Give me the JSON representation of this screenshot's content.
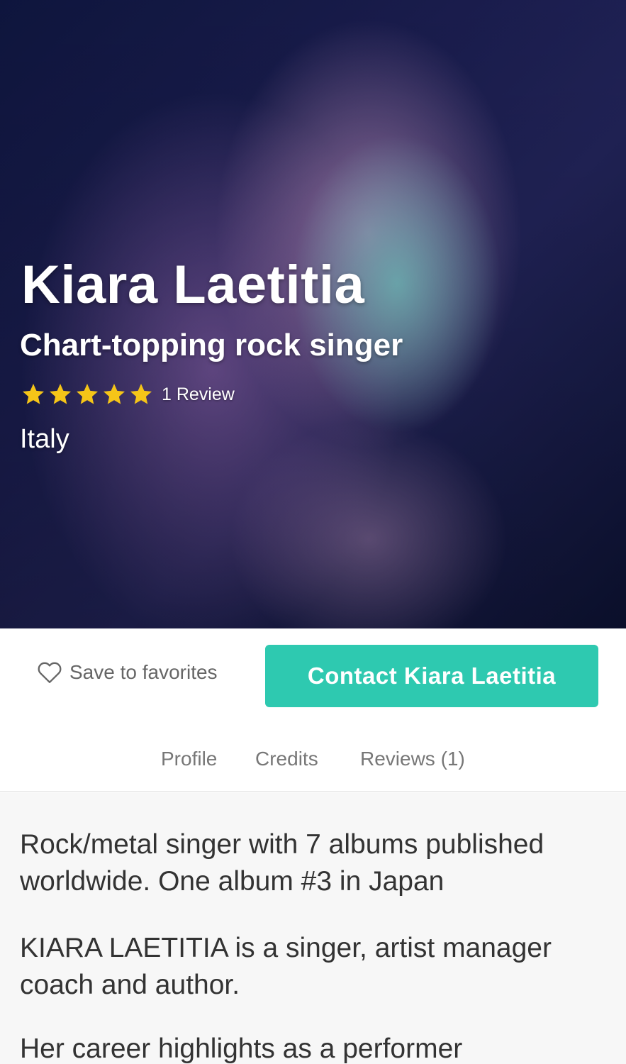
{
  "hero": {
    "name": "Kiara Laetitia",
    "tagline": "Chart-topping rock singer",
    "rating_stars": 5,
    "review_count_label": "1 Review",
    "location": "Italy",
    "star_color": "#f5c518"
  },
  "actions": {
    "save_label": "Save to favorites",
    "contact_label": "Contact Kiara Laetitia",
    "accent_color": "#2ec9b0"
  },
  "tabs": [
    {
      "label": "Profile"
    },
    {
      "label": "Credits"
    },
    {
      "label": "Reviews (1)"
    }
  ],
  "bio": {
    "headline": "Rock/metal singer with 7 albums published worldwide. One album #3 in Japan",
    "intro": "KIARA LAETITIA is a singer, artist manager coach and author.",
    "highlights_start": "Her career highlights as a performer"
  }
}
